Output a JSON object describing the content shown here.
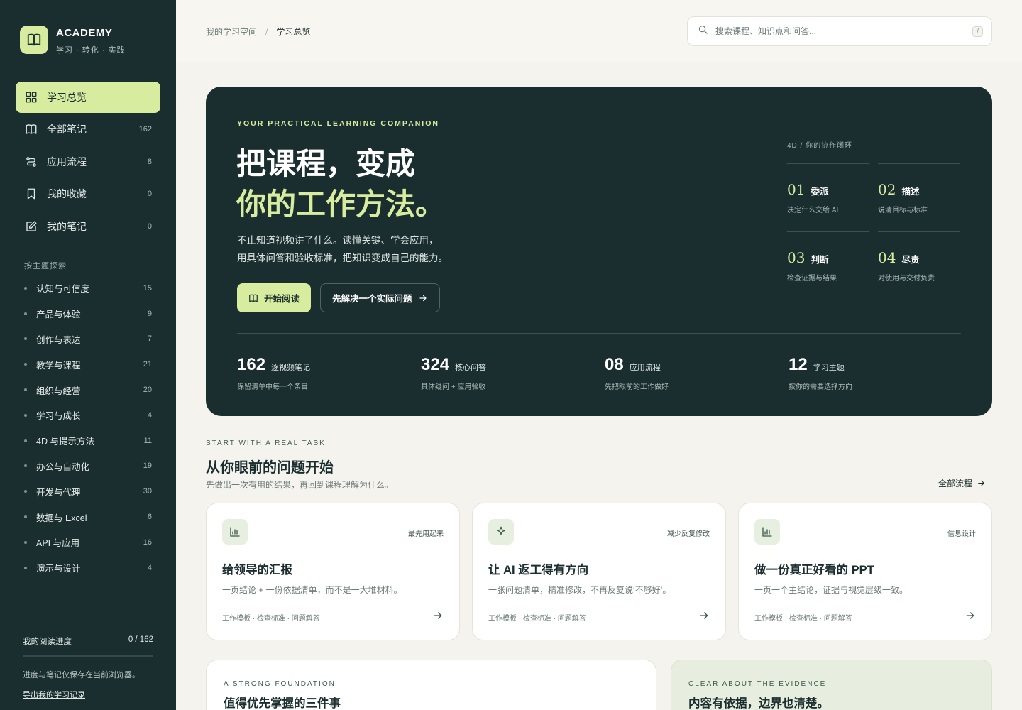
{
  "brand": {
    "name": "ACADEMY",
    "tagline": "学习 · 转化 · 实践"
  },
  "nav": [
    {
      "label": "学习总览",
      "count": ""
    },
    {
      "label": "全部笔记",
      "count": "162"
    },
    {
      "label": "应用流程",
      "count": "8"
    },
    {
      "label": "我的收藏",
      "count": "0"
    },
    {
      "label": "我的笔记",
      "count": "0"
    }
  ],
  "topics_heading": "按主题探索",
  "topics": [
    {
      "label": "认知与可信度",
      "count": "15"
    },
    {
      "label": "产品与体验",
      "count": "9"
    },
    {
      "label": "创作与表达",
      "count": "7"
    },
    {
      "label": "教学与课程",
      "count": "21"
    },
    {
      "label": "组织与经营",
      "count": "20"
    },
    {
      "label": "学习与成长",
      "count": "4"
    },
    {
      "label": "4D 与提示方法",
      "count": "11"
    },
    {
      "label": "办公与自动化",
      "count": "19"
    },
    {
      "label": "开发与代理",
      "count": "30"
    },
    {
      "label": "数据与 Excel",
      "count": "6"
    },
    {
      "label": "API 与应用",
      "count": "16"
    },
    {
      "label": "演示与设计",
      "count": "4"
    }
  ],
  "progress": {
    "label": "我的阅读进度",
    "value": "0 / 162",
    "fraction": 0,
    "note": "进度与笔记仅保存在当前浏览器。",
    "export_link": "导出我的学习记录"
  },
  "breadcrumb": {
    "parent": "我的学习空间",
    "sep": "/",
    "current": "学习总览"
  },
  "search": {
    "placeholder": "搜索课程、知识点和问答...",
    "shortcut": "/"
  },
  "hero": {
    "eyebrow": "YOUR PRACTICAL LEARNING COMPANION",
    "title_line1": "把课程，变成",
    "title_line2": "你的工作方法。",
    "desc_line1": "不止知道视频讲了什么。读懂关键、学会应用，",
    "desc_line2": "用具体问答和验收标准，把知识变成自己的能力。",
    "primary_btn": "开始阅读",
    "secondary_btn": "先解决一个实际问题",
    "loop_heading": "4D / 你的协作闭环",
    "loop": [
      {
        "num": "01",
        "name": "委派",
        "desc": "决定什么交给 AI"
      },
      {
        "num": "02",
        "name": "描述",
        "desc": "说清目标与标准"
      },
      {
        "num": "03",
        "name": "判断",
        "desc": "检查证据与结果"
      },
      {
        "num": "04",
        "name": "尽责",
        "desc": "对使用与交付负责"
      }
    ],
    "stats": [
      {
        "num": "162",
        "label": "逐视频笔记",
        "sub": "保留清单中每一个条目"
      },
      {
        "num": "324",
        "label": "核心问答",
        "sub": "具体疑问 + 应用验收"
      },
      {
        "num": "08",
        "label": "应用流程",
        "sub": "先把眼前的工作做好"
      },
      {
        "num": "12",
        "label": "学习主题",
        "sub": "按你的需要选择方向"
      }
    ]
  },
  "section": {
    "eyebrow": "START WITH A REAL TASK",
    "title": "从你眼前的问题开始",
    "sub": "先做出一次有用的结果，再回到课程理解为什么。",
    "link": "全部流程"
  },
  "cards": [
    {
      "icon": "bar-chart-icon",
      "tag": "最先用起来",
      "title": "给领导的汇报",
      "desc": "一页结论 + 一份依据清单，而不是一大堆材料。",
      "meta": "工作模板 · 检查标准 · 问题解答"
    },
    {
      "icon": "sparkle-icon",
      "tag": "减少反复修改",
      "title": "让 AI 返工得有方向",
      "desc": "一张问题清单，精准修改，不再反复说‘不够好’。",
      "meta": "工作模板 · 检查标准 · 问题解答"
    },
    {
      "icon": "bar-chart-icon",
      "tag": "信息设计",
      "title": "做一份真正好看的 PPT",
      "desc": "一页一个主结论，证据与视觉层级一致。",
      "meta": "工作模板 · 检查标准 · 问题解答"
    }
  ],
  "bottom": {
    "left_eyebrow": "A STRONG FOUNDATION",
    "left_title": "值得优先掌握的三件事",
    "right_eyebrow": "CLEAR ABOUT THE EVIDENCE",
    "right_title": "内容有依据，边界也清楚。"
  },
  "colors": {
    "sidebar": "#1a2e30",
    "accent": "#d7ec9f",
    "background": "#f4f3ee"
  }
}
